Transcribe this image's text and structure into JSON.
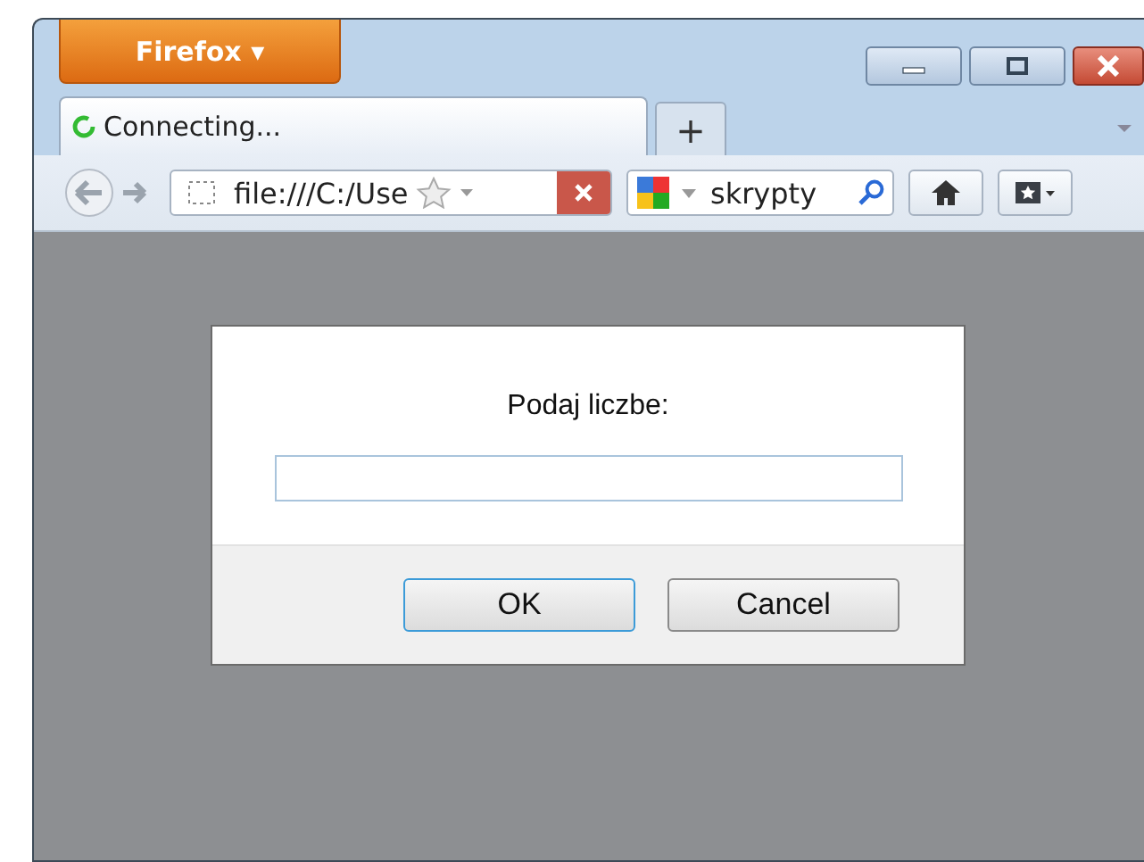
{
  "window": {
    "menu_button": "Firefox ▾"
  },
  "tabs": [
    {
      "title": "Connecting...",
      "selected": true,
      "loading": true
    }
  ],
  "new_tab": "+",
  "address_bar": {
    "value": "file:///C:/Use"
  },
  "search_bar": {
    "value": "skrypty"
  },
  "dialog": {
    "message": "Podaj liczbe:",
    "buttons": [
      {
        "label": "OK",
        "default": true
      },
      {
        "label": "Cancel",
        "default": false
      }
    ]
  }
}
